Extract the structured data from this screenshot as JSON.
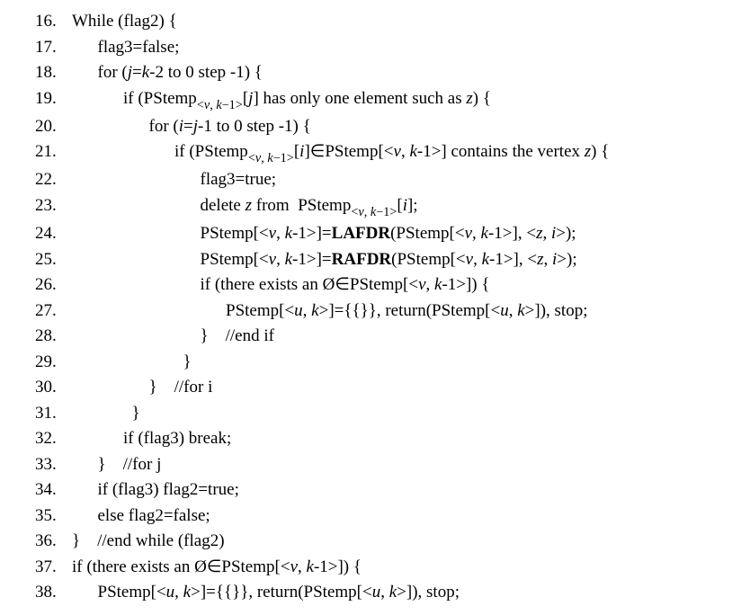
{
  "lines": [
    {
      "n": "16",
      "indent": 0,
      "tokens": [
        {
          "t": "While (flag2) {"
        }
      ]
    },
    {
      "n": "17",
      "indent": 1,
      "tokens": [
        {
          "t": "flag3=false;"
        }
      ]
    },
    {
      "n": "18",
      "indent": 1,
      "tokens": [
        {
          "t": "for ("
        },
        {
          "t": "j",
          "it": true
        },
        {
          "t": "="
        },
        {
          "t": "k",
          "it": true
        },
        {
          "t": "-2 to 0 step -1) {"
        }
      ]
    },
    {
      "n": "19",
      "indent": 2,
      "tokens": [
        {
          "t": "if (PStemp"
        },
        {
          "sub": true,
          "tokens": [
            {
              "t": "<"
            },
            {
              "t": "v",
              "it": true
            },
            {
              "t": ", "
            },
            {
              "t": "k",
              "it": true
            },
            {
              "t": "−1>"
            }
          ]
        },
        {
          "t": "["
        },
        {
          "t": "j",
          "it": true
        },
        {
          "t": "] has only one element such as "
        },
        {
          "t": "z",
          "it": true
        },
        {
          "t": ") {"
        }
      ]
    },
    {
      "n": "20",
      "indent": 3,
      "tokens": [
        {
          "t": "for ("
        },
        {
          "t": "i",
          "it": true
        },
        {
          "t": "="
        },
        {
          "t": "j",
          "it": true
        },
        {
          "t": "-1 to 0 step -1) {"
        }
      ]
    },
    {
      "n": "21",
      "indent": 4,
      "tokens": [
        {
          "t": "if (PStemp"
        },
        {
          "sub": true,
          "tokens": [
            {
              "t": "<"
            },
            {
              "t": "v",
              "it": true
            },
            {
              "t": ", "
            },
            {
              "t": "k",
              "it": true
            },
            {
              "t": "−1>"
            }
          ]
        },
        {
          "t": "["
        },
        {
          "t": "i",
          "it": true
        },
        {
          "t": "]∈PStemp[<"
        },
        {
          "t": "v",
          "it": true
        },
        {
          "t": ", "
        },
        {
          "t": "k",
          "it": true
        },
        {
          "t": "-1>] contains the vertex "
        },
        {
          "t": "z",
          "it": true
        },
        {
          "t": ") {"
        }
      ]
    },
    {
      "n": "22",
      "indent": 5,
      "tokens": [
        {
          "t": "flag3=true;"
        }
      ]
    },
    {
      "n": "23",
      "indent": 5,
      "tokens": [
        {
          "t": "delete "
        },
        {
          "t": "z",
          "it": true
        },
        {
          "t": " from  PStemp"
        },
        {
          "sub": true,
          "tokens": [
            {
              "t": "<"
            },
            {
              "t": "v",
              "it": true
            },
            {
              "t": ", "
            },
            {
              "t": "k",
              "it": true
            },
            {
              "t": "−1>"
            }
          ]
        },
        {
          "t": "["
        },
        {
          "t": "i",
          "it": true
        },
        {
          "t": "];"
        }
      ]
    },
    {
      "n": "24",
      "indent": 5,
      "tokens": [
        {
          "t": "PStemp[<"
        },
        {
          "t": "v",
          "it": true
        },
        {
          "t": ", "
        },
        {
          "t": "k",
          "it": true
        },
        {
          "t": "-1>]="
        },
        {
          "t": "LAFDR",
          "bf": true
        },
        {
          "t": "(PStemp[<"
        },
        {
          "t": "v",
          "it": true
        },
        {
          "t": ", "
        },
        {
          "t": "k",
          "it": true
        },
        {
          "t": "-1>], <"
        },
        {
          "t": "z",
          "it": true
        },
        {
          "t": ", "
        },
        {
          "t": "i",
          "it": true
        },
        {
          "t": ">);"
        }
      ]
    },
    {
      "n": "25",
      "indent": 5,
      "tokens": [
        {
          "t": "PStemp[<"
        },
        {
          "t": "v",
          "it": true
        },
        {
          "t": ", "
        },
        {
          "t": "k",
          "it": true
        },
        {
          "t": "-1>]="
        },
        {
          "t": "RAFDR",
          "bf": true
        },
        {
          "t": "(PStemp[<"
        },
        {
          "t": "v",
          "it": true
        },
        {
          "t": ", "
        },
        {
          "t": "k",
          "it": true
        },
        {
          "t": "-1>], <"
        },
        {
          "t": "z",
          "it": true
        },
        {
          "t": ", "
        },
        {
          "t": "i",
          "it": true
        },
        {
          "t": ">);"
        }
      ]
    },
    {
      "n": "26",
      "indent": 5,
      "tokens": [
        {
          "t": "if (there exists an Ø∈PStemp[<"
        },
        {
          "t": "v",
          "it": true
        },
        {
          "t": ", "
        },
        {
          "t": "k",
          "it": true
        },
        {
          "t": "-1>]) {"
        }
      ]
    },
    {
      "n": "27",
      "indent": 6,
      "tokens": [
        {
          "t": "PStemp[<"
        },
        {
          "t": "u",
          "it": true
        },
        {
          "t": ", "
        },
        {
          "t": "k",
          "it": true
        },
        {
          "t": ">]={{}}, return(PStemp[<"
        },
        {
          "t": "u",
          "it": true
        },
        {
          "t": ", "
        },
        {
          "t": "k",
          "it": true
        },
        {
          "t": ">]), stop;"
        }
      ]
    },
    {
      "n": "28",
      "indent": 5,
      "tokens": [
        {
          "t": "}    //end if"
        }
      ]
    },
    {
      "n": "29",
      "indent": 4,
      "tokens": [
        {
          "t": "  }"
        }
      ]
    },
    {
      "n": "30",
      "indent": 3,
      "tokens": [
        {
          "t": "}    //for i"
        }
      ]
    },
    {
      "n": "31",
      "indent": 2,
      "tokens": [
        {
          "t": "  }"
        }
      ]
    },
    {
      "n": "32",
      "indent": 2,
      "tokens": [
        {
          "t": "if (flag3) break;"
        }
      ]
    },
    {
      "n": "33",
      "indent": 1,
      "tokens": [
        {
          "t": "}    //for j"
        }
      ]
    },
    {
      "n": "34",
      "indent": 1,
      "tokens": [
        {
          "t": "if (flag3) flag2=true;"
        }
      ]
    },
    {
      "n": "35",
      "indent": 1,
      "tokens": [
        {
          "t": "else flag2=false;"
        }
      ]
    },
    {
      "n": "36",
      "indent": 0,
      "tokens": [
        {
          "t": "}    //end while (flag2)"
        }
      ]
    },
    {
      "n": "37",
      "indent": 0,
      "tokens": [
        {
          "t": "if (there exists an Ø∈PStemp[<"
        },
        {
          "t": "v",
          "it": true
        },
        {
          "t": ", "
        },
        {
          "t": "k",
          "it": true
        },
        {
          "t": "-1>]) {"
        }
      ]
    },
    {
      "n": "38",
      "indent": 1,
      "tokens": [
        {
          "t": "PStemp[<"
        },
        {
          "t": "u",
          "it": true
        },
        {
          "t": ", "
        },
        {
          "t": "k",
          "it": true
        },
        {
          "t": ">]={{}}, return(PStemp[<"
        },
        {
          "t": "u",
          "it": true
        },
        {
          "t": ", "
        },
        {
          "t": "k",
          "it": true
        },
        {
          "t": ">]), stop;"
        }
      ]
    }
  ]
}
